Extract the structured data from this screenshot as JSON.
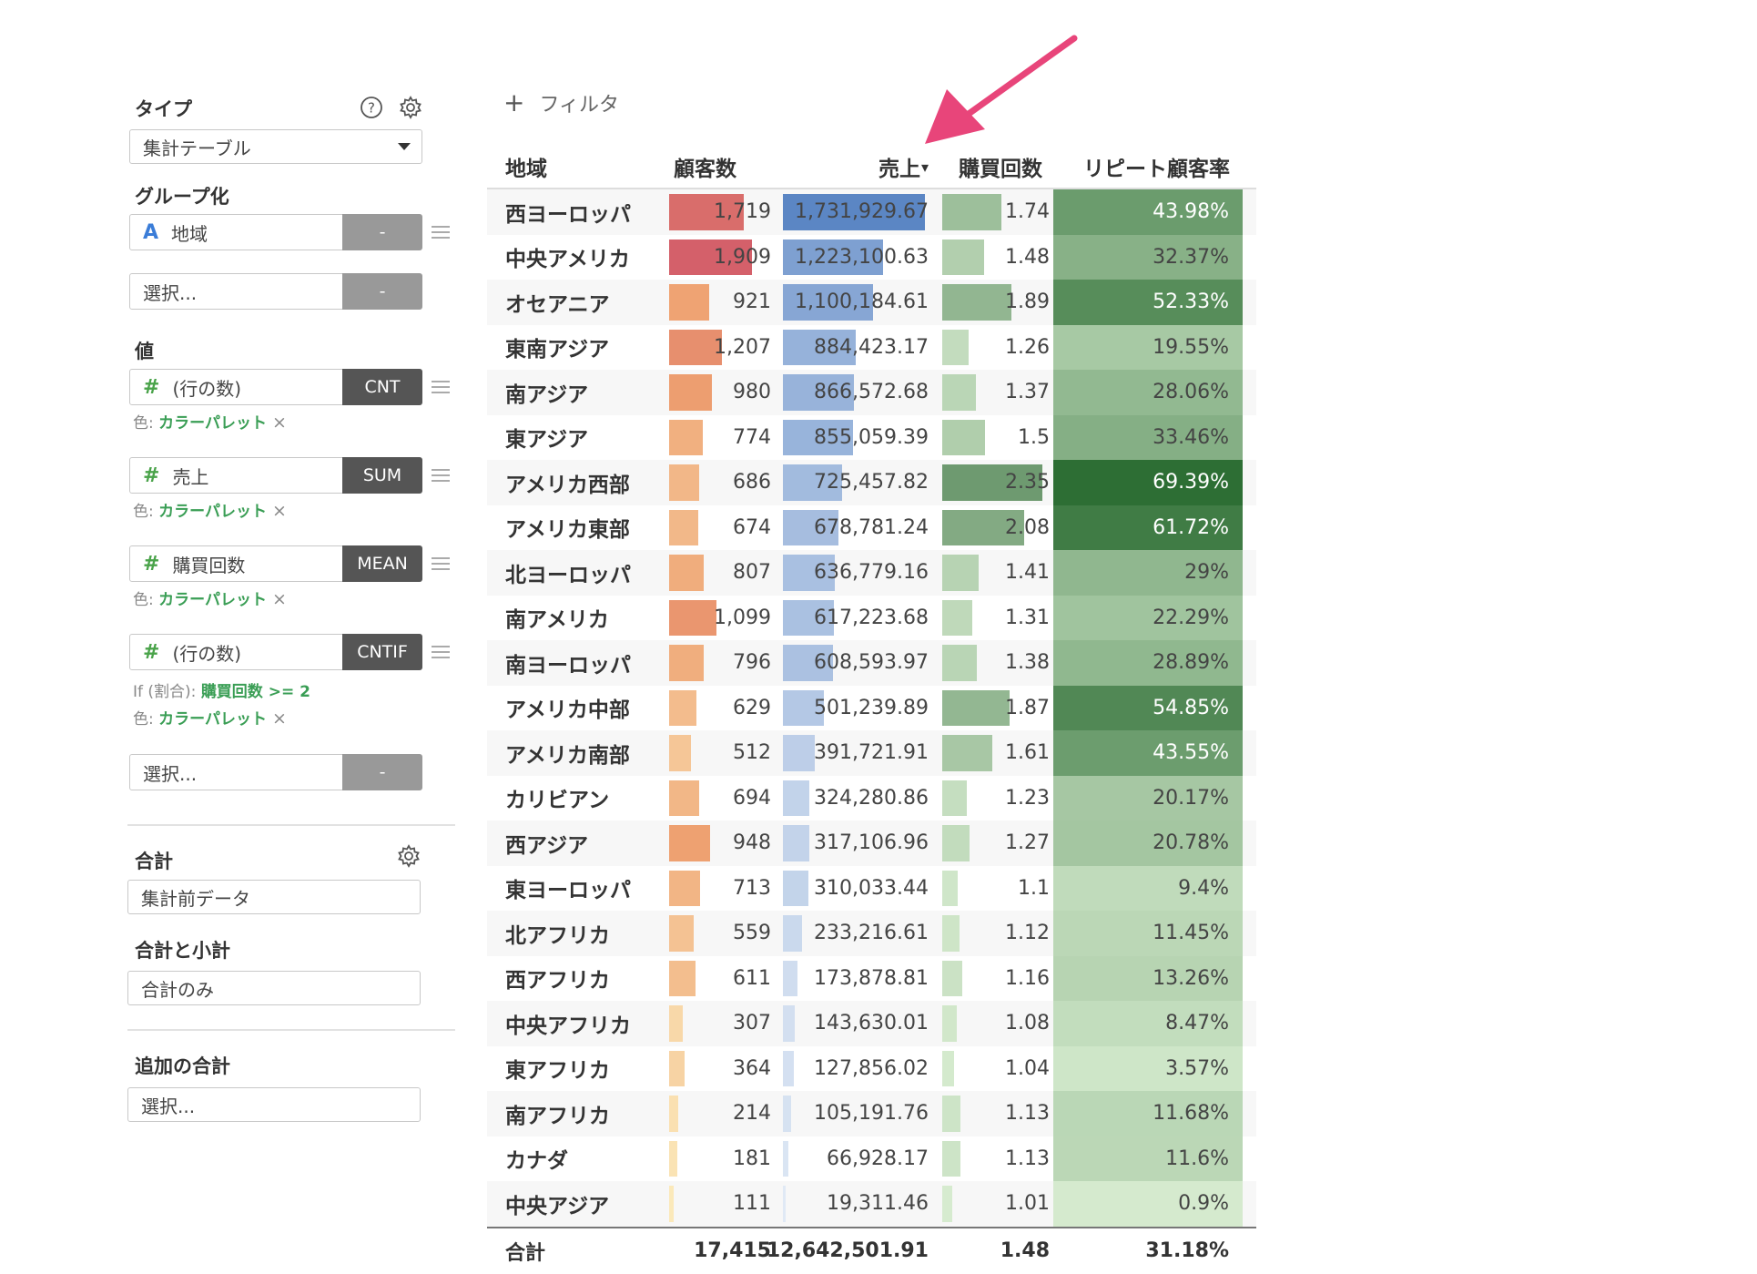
{
  "panel": {
    "type_label": "タイプ",
    "type_value": "集計テーブル",
    "group_label": "グループ化",
    "group_field_type": "A",
    "group_field": "地域",
    "group_field_btn": "-",
    "group_select": "選択...",
    "group_select_btn": "-",
    "value_label": "値",
    "values": [
      {
        "type": "#",
        "name": "(行の数)",
        "agg": "CNT",
        "if_prefix": "",
        "if_value": "",
        "color_prefix": "色: ",
        "color_value": "カラーパレット",
        "remove": "×"
      },
      {
        "type": "#",
        "name": "売上",
        "agg": "SUM",
        "if_prefix": "",
        "if_value": "",
        "color_prefix": "色: ",
        "color_value": "カラーパレット",
        "remove": "×"
      },
      {
        "type": "#",
        "name": "購買回数",
        "agg": "MEAN",
        "if_prefix": "",
        "if_value": "",
        "color_prefix": "色: ",
        "color_value": "カラーパレット",
        "remove": "×"
      },
      {
        "type": "#",
        "name": "(行の数)",
        "agg": "CNTIF",
        "if_prefix": "If (割合): ",
        "if_value": "購買回数 >= 2",
        "color_prefix": "色: ",
        "color_value": "カラーパレット",
        "remove": "×"
      }
    ],
    "value_select": "選択...",
    "value_select_btn": "-",
    "total_label": "合計",
    "total_value": "集計前データ",
    "subtotal_label": "合計と小計",
    "subtotal_value": "合計のみ",
    "extra_total_label": "追加の合計",
    "extra_total_value": "選択...",
    "icons": {
      "help": "help-circle-icon",
      "settings": "gear-icon"
    }
  },
  "filter": {
    "plus": "+",
    "label": "フィルタ"
  },
  "table": {
    "headers": [
      "地域",
      "顧客数",
      "売上",
      "購買回数",
      "リピート顧客率"
    ],
    "sort_indicator": "▾",
    "rows": [
      {
        "region": "西ヨーロッパ",
        "customers": "1,719",
        "sales": "1,731,929.67",
        "purchases": "1.74",
        "repeat": "43.98%"
      },
      {
        "region": "中央アメリカ",
        "customers": "1,909",
        "sales": "1,223,100.63",
        "purchases": "1.48",
        "repeat": "32.37%"
      },
      {
        "region": "オセアニア",
        "customers": "921",
        "sales": "1,100,184.61",
        "purchases": "1.89",
        "repeat": "52.33%"
      },
      {
        "region": "東南アジア",
        "customers": "1,207",
        "sales": "884,423.17",
        "purchases": "1.26",
        "repeat": "19.55%"
      },
      {
        "region": "南アジア",
        "customers": "980",
        "sales": "866,572.68",
        "purchases": "1.37",
        "repeat": "28.06%"
      },
      {
        "region": "東アジア",
        "customers": "774",
        "sales": "855,059.39",
        "purchases": "1.5",
        "repeat": "33.46%"
      },
      {
        "region": "アメリカ西部",
        "customers": "686",
        "sales": "725,457.82",
        "purchases": "2.35",
        "repeat": "69.39%"
      },
      {
        "region": "アメリカ東部",
        "customers": "674",
        "sales": "678,781.24",
        "purchases": "2.08",
        "repeat": "61.72%"
      },
      {
        "region": "北ヨーロッパ",
        "customers": "807",
        "sales": "636,779.16",
        "purchases": "1.41",
        "repeat": "29%"
      },
      {
        "region": "南アメリカ",
        "customers": "1,099",
        "sales": "617,223.68",
        "purchases": "1.31",
        "repeat": "22.29%"
      },
      {
        "region": "南ヨーロッパ",
        "customers": "796",
        "sales": "608,593.97",
        "purchases": "1.38",
        "repeat": "28.89%"
      },
      {
        "region": "アメリカ中部",
        "customers": "629",
        "sales": "501,239.89",
        "purchases": "1.87",
        "repeat": "54.85%"
      },
      {
        "region": "アメリカ南部",
        "customers": "512",
        "sales": "391,721.91",
        "purchases": "1.61",
        "repeat": "43.55%"
      },
      {
        "region": "カリビアン",
        "customers": "694",
        "sales": "324,280.86",
        "purchases": "1.23",
        "repeat": "20.17%"
      },
      {
        "region": "西アジア",
        "customers": "948",
        "sales": "317,106.96",
        "purchases": "1.27",
        "repeat": "20.78%"
      },
      {
        "region": "東ヨーロッパ",
        "customers": "713",
        "sales": "310,033.44",
        "purchases": "1.1",
        "repeat": "9.4%"
      },
      {
        "region": "北アフリカ",
        "customers": "559",
        "sales": "233,216.61",
        "purchases": "1.12",
        "repeat": "11.45%"
      },
      {
        "region": "西アフリカ",
        "customers": "611",
        "sales": "173,878.81",
        "purchases": "1.16",
        "repeat": "13.26%"
      },
      {
        "region": "中央アフリカ",
        "customers": "307",
        "sales": "143,630.01",
        "purchases": "1.08",
        "repeat": "8.47%"
      },
      {
        "region": "東アフリカ",
        "customers": "364",
        "sales": "127,856.02",
        "purchases": "1.04",
        "repeat": "3.57%"
      },
      {
        "region": "南アフリカ",
        "customers": "214",
        "sales": "105,191.76",
        "purchases": "1.13",
        "repeat": "11.68%"
      },
      {
        "region": "カナダ",
        "customers": "181",
        "sales": "66,928.17",
        "purchases": "1.13",
        "repeat": "11.6%"
      },
      {
        "region": "中央アジア",
        "customers": "111",
        "sales": "19,311.46",
        "purchases": "1.01",
        "repeat": "0.9%"
      }
    ],
    "total": {
      "label": "合計",
      "customers": "17,415",
      "sales": "12,642,501.91",
      "purchases": "1.48",
      "repeat": "31.18%"
    }
  },
  "colors": {
    "arrow": "#e8457a",
    "sales_bar": "#5b86c4",
    "green_dark": "#2d6e34",
    "green_light": "#d7ecd0",
    "link_green": "#3a9e55"
  }
}
